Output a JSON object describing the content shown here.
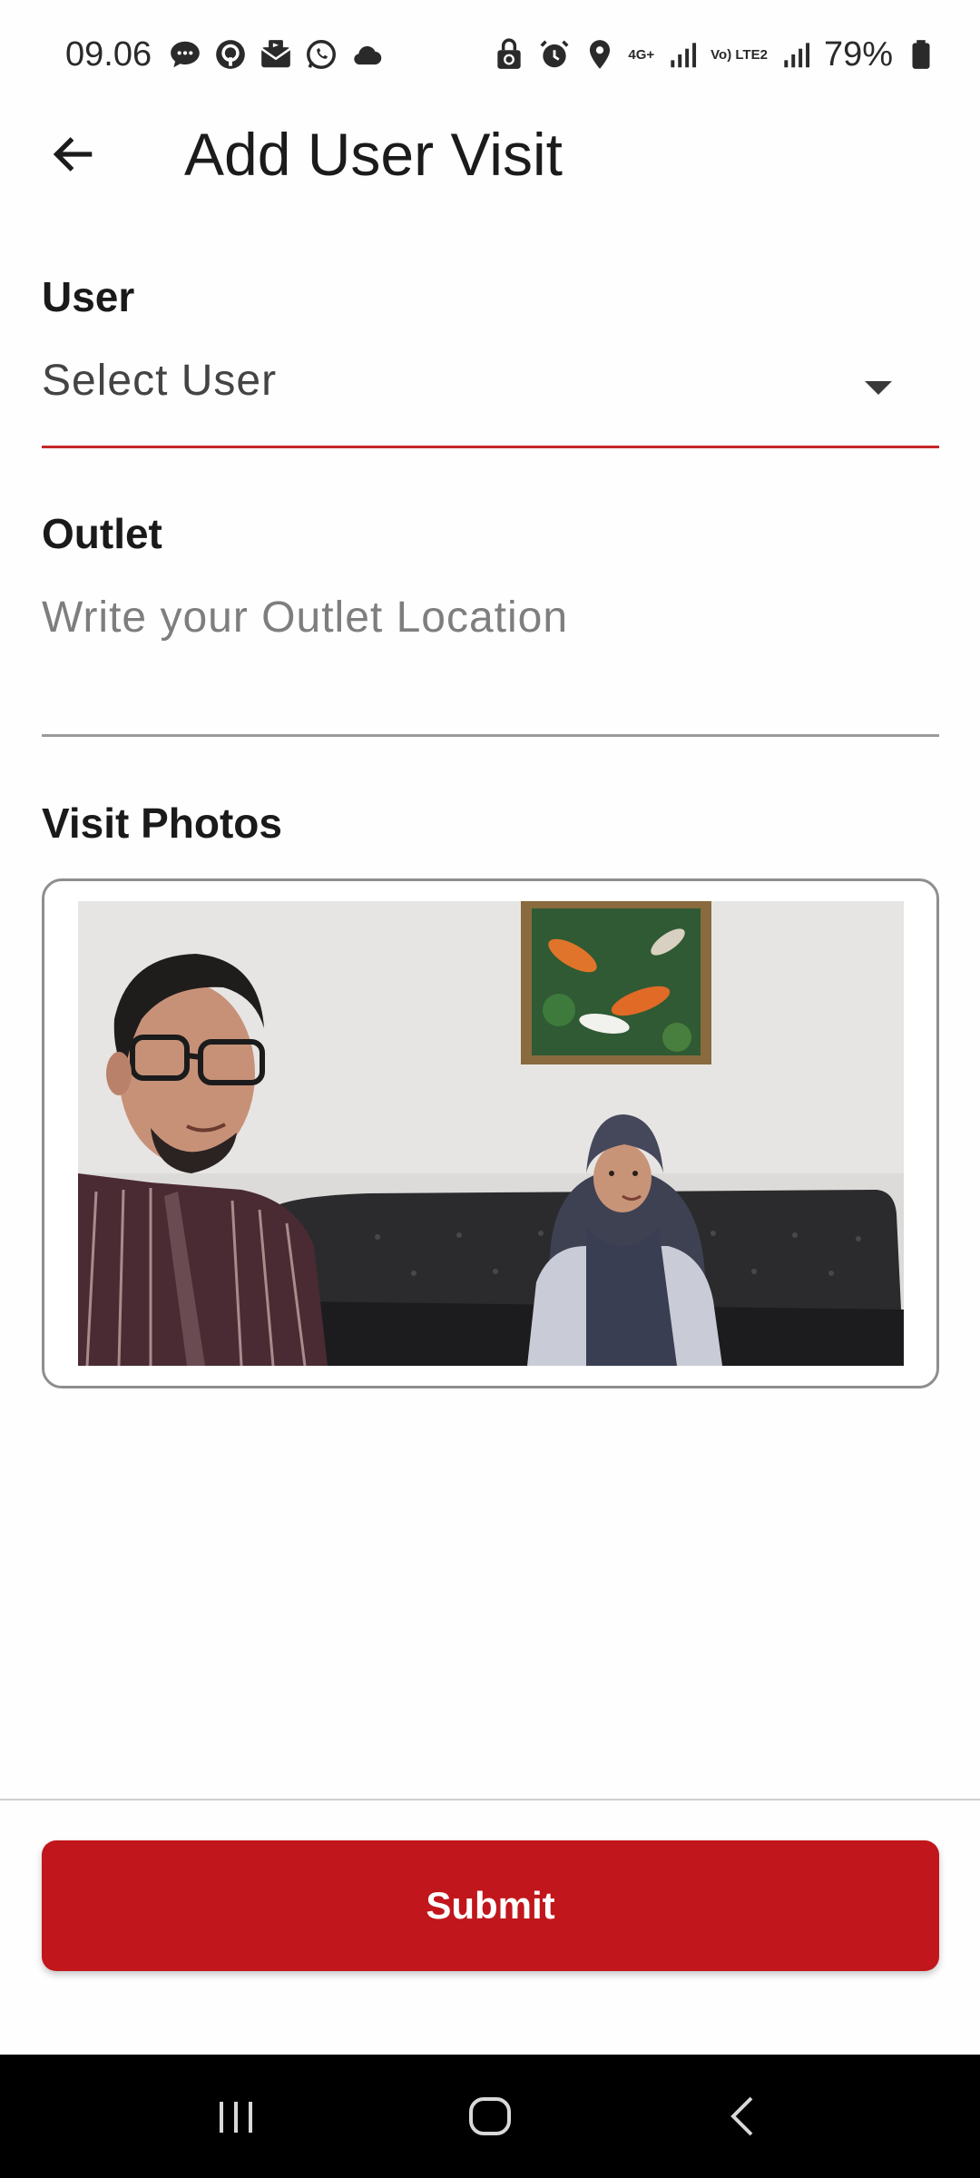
{
  "status_bar": {
    "time": "09.06",
    "network_1": "4G+",
    "network_2": "Vo) LTE2",
    "battery": "79%",
    "icons": [
      "chat-icon",
      "podcast-icon",
      "gallery-mail-icon",
      "whatsapp-icon",
      "cloud-icon",
      "lock-recycle-icon",
      "alarm-icon",
      "location-icon",
      "signal-icon",
      "signal-icon",
      "battery-icon"
    ]
  },
  "app_bar": {
    "title": "Add User Visit",
    "back_icon": "arrow-left-icon"
  },
  "form": {
    "user_label": "User",
    "user_select": "Select User",
    "outlet_label": "Outlet",
    "outlet_placeholder": "Write your Outlet Location",
    "outlet_value": "",
    "photos_label": "Visit Photos"
  },
  "actions": {
    "submit_label": "Submit"
  },
  "colors": {
    "accent": "#c1161b",
    "underline_active": "#c62828",
    "underline_idle": "#9a9a9a"
  },
  "nav_bar": {
    "icons": [
      "recent-apps-icon",
      "home-icon",
      "back-icon"
    ]
  }
}
